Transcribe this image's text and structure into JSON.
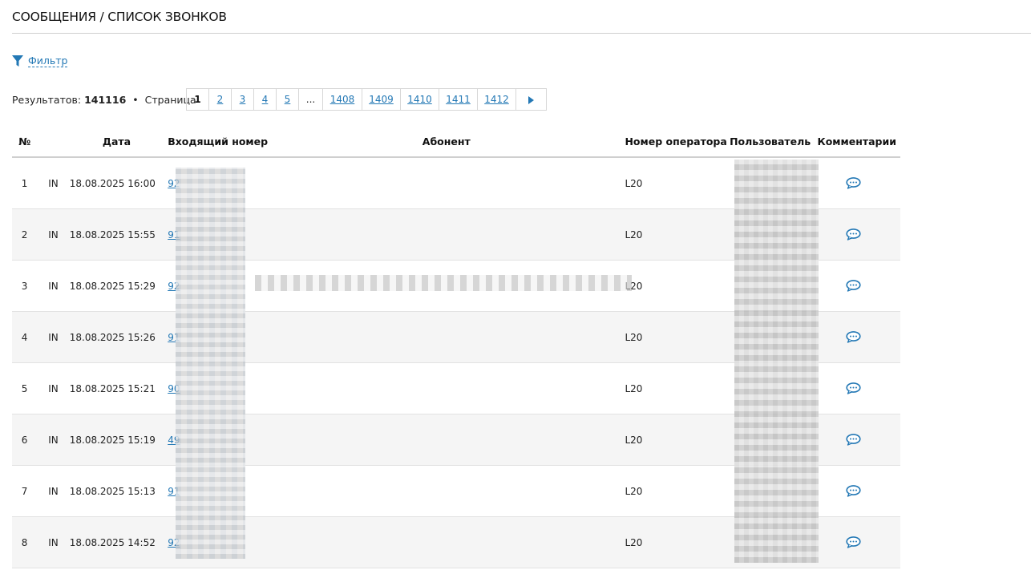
{
  "page": {
    "title": "СООБЩЕНИЯ / СПИСОК ЗВОНКОВ"
  },
  "filter": {
    "label": "Фильтр",
    "icon": "filter-icon"
  },
  "results": {
    "label": "Результатов:",
    "count": "141116",
    "separator": "•",
    "page_label": "Страница"
  },
  "pagination": {
    "pages": [
      "1",
      "2",
      "3",
      "4",
      "5",
      "...",
      "1408",
      "1409",
      "1410",
      "1411",
      "1412"
    ],
    "current": "1",
    "next_icon": "next-arrow-icon"
  },
  "table": {
    "headers": {
      "num": "№",
      "dir": "",
      "date": "Дата",
      "phone": "Входящий номер",
      "subscriber": "Абонент",
      "operator": "Номер оператора",
      "user": "Пользователь",
      "comments": "Комментарии"
    },
    "rows": [
      {
        "num": "1",
        "dir": "IN",
        "date": "18.08.2025 16:00",
        "phone": "92",
        "subscriber": "",
        "operator": "L20",
        "user": ""
      },
      {
        "num": "2",
        "dir": "IN",
        "date": "18.08.2025 15:55",
        "phone": "91",
        "subscriber": "",
        "operator": "L20",
        "user": ""
      },
      {
        "num": "3",
        "dir": "IN",
        "date": "18.08.2025 15:29",
        "phone": "92",
        "subscriber": "",
        "operator": "L20",
        "user": ""
      },
      {
        "num": "4",
        "dir": "IN",
        "date": "18.08.2025 15:26",
        "phone": "91",
        "subscriber": "",
        "operator": "L20",
        "user": ""
      },
      {
        "num": "5",
        "dir": "IN",
        "date": "18.08.2025 15:21",
        "phone": "90",
        "subscriber": "",
        "operator": "L20",
        "user": ""
      },
      {
        "num": "6",
        "dir": "IN",
        "date": "18.08.2025 15:19",
        "phone": "49",
        "subscriber": "",
        "operator": "L20",
        "user": ""
      },
      {
        "num": "7",
        "dir": "IN",
        "date": "18.08.2025 15:13",
        "phone": "91",
        "subscriber": "",
        "operator": "L20",
        "user": ""
      },
      {
        "num": "8",
        "dir": "IN",
        "date": "18.08.2025 14:52",
        "phone": "92",
        "subscriber": "",
        "operator": "L20",
        "user": ""
      }
    ],
    "comment_icon": "comment-icon"
  },
  "colors": {
    "link": "#2378b5",
    "row_alt": "#f5f5f5",
    "border": "#cfcfcf"
  }
}
